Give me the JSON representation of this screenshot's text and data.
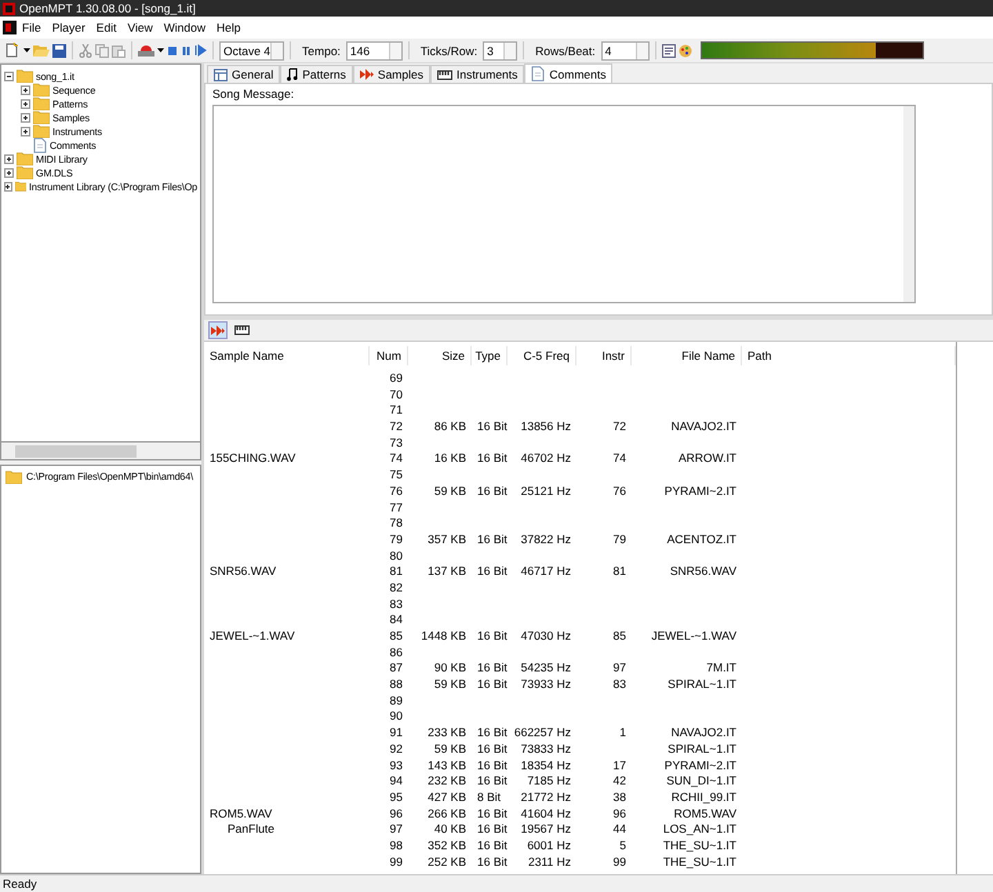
{
  "window": {
    "title": "OpenMPT 1.30.08.00 - [song_1.it]"
  },
  "menu": [
    "File",
    "Player",
    "Edit",
    "View",
    "Window",
    "Help"
  ],
  "toolbar": {
    "octave": "Octave 4",
    "tempo_label": "Tempo:",
    "tempo": "146",
    "ticks_label": "Ticks/Row:",
    "ticks": "3",
    "rows_label": "Rows/Beat:",
    "rows": "4",
    "vu_meter": {
      "level": 0.79
    }
  },
  "tree": [
    {
      "label": "song_1.it",
      "kind": "folder",
      "expanded": true,
      "children": [
        {
          "label": "Sequence",
          "kind": "folder",
          "expanded": false
        },
        {
          "label": "Patterns",
          "kind": "folder",
          "expanded": false
        },
        {
          "label": "Samples",
          "kind": "folder",
          "expanded": false
        },
        {
          "label": "Instruments",
          "kind": "folder",
          "expanded": false
        },
        {
          "label": "Comments",
          "kind": "document"
        }
      ]
    },
    {
      "label": "MIDI Library",
      "kind": "folder",
      "expanded": false
    },
    {
      "label": "GM.DLS",
      "kind": "folder",
      "expanded": false
    },
    {
      "label": "Instrument Library (C:\\Program Files\\Op",
      "kind": "folder",
      "expanded": false
    }
  ],
  "folder_path": "C:\\Program Files\\OpenMPT\\bin\\amd64\\",
  "tabs": [
    {
      "label": "General",
      "selected": false
    },
    {
      "label": "Patterns",
      "selected": false
    },
    {
      "label": "Samples",
      "selected": false
    },
    {
      "label": "Instruments",
      "selected": false
    },
    {
      "label": "Comments",
      "selected": true
    }
  ],
  "song_message_label": "Song Message:",
  "sample_list": {
    "columns": [
      "Sample Name",
      "Num",
      "Size",
      "Type",
      "C-5 Freq",
      "Instr",
      "File Name",
      "Path"
    ],
    "rows": [
      {
        "num": "69"
      },
      {
        "num": "70"
      },
      {
        "num": "71"
      },
      {
        "num": "72",
        "size": "86 KB",
        "type": "16 Bit",
        "freq": "13856 Hz",
        "instr": "72",
        "file": "NAVAJO2.IT"
      },
      {
        "num": "73"
      },
      {
        "name": "155CHING.WAV",
        "num": "74",
        "size": "16 KB",
        "type": "16 Bit",
        "freq": "46702 Hz",
        "instr": "74",
        "file": "ARROW.IT"
      },
      {
        "num": "75"
      },
      {
        "num": "76",
        "size": "59 KB",
        "type": "16 Bit",
        "freq": "25121 Hz",
        "instr": "76",
        "file": "PYRAMI~2.IT"
      },
      {
        "num": "77"
      },
      {
        "num": "78"
      },
      {
        "num": "79",
        "size": "357 KB",
        "type": "16 Bit",
        "freq": "37822 Hz",
        "instr": "79",
        "file": "ACENTOZ.IT"
      },
      {
        "num": "80"
      },
      {
        "name": "SNR56.WAV",
        "num": "81",
        "size": "137 KB",
        "type": "16 Bit",
        "freq": "46717 Hz",
        "instr": "81",
        "file": "SNR56.WAV"
      },
      {
        "num": "82"
      },
      {
        "num": "83"
      },
      {
        "num": "84"
      },
      {
        "name": "JEWEL-~1.WAV",
        "num": "85",
        "size": "1448 KB",
        "type": "16 Bit",
        "freq": "47030 Hz",
        "instr": "85",
        "file": "JEWEL-~1.WAV"
      },
      {
        "num": "86"
      },
      {
        "num": "87",
        "size": "90 KB",
        "type": "16 Bit",
        "freq": "54235 Hz",
        "instr": "97",
        "file": "7M.IT"
      },
      {
        "num": "88",
        "size": "59 KB",
        "type": "16 Bit",
        "freq": "73933 Hz",
        "instr": "83",
        "file": "SPIRAL~1.IT"
      },
      {
        "num": "89"
      },
      {
        "num": "90"
      },
      {
        "num": "91",
        "size": "233 KB",
        "type": "16 Bit",
        "freq": "662257 Hz",
        "instr": "1",
        "file": "NAVAJO2.IT"
      },
      {
        "num": "92",
        "size": "59 KB",
        "type": "16 Bit",
        "freq": "73833 Hz",
        "file": "SPIRAL~1.IT"
      },
      {
        "num": "93",
        "size": "143 KB",
        "type": "16 Bit",
        "freq": "18354 Hz",
        "instr": "17",
        "file": "PYRAMI~2.IT"
      },
      {
        "num": "94",
        "size": "232 KB",
        "type": "16 Bit",
        "freq": "7185 Hz",
        "instr": "42",
        "file": "SUN_DI~1.IT"
      },
      {
        "num": "95",
        "size": "427 KB",
        "type": "8 Bit",
        "freq": "21772 Hz",
        "instr": "38",
        "file": "RCHII_99.IT"
      },
      {
        "name": "ROM5.WAV",
        "num": "96",
        "size": "266 KB",
        "type": "16 Bit",
        "freq": "41604 Hz",
        "instr": "96",
        "file": "ROM5.WAV"
      },
      {
        "instrument_name": "PanFlute",
        "num": "97",
        "size": "40 KB",
        "type": "16 Bit",
        "freq": "19567 Hz",
        "instr": "44",
        "file": "LOS_AN~1.IT"
      },
      {
        "num": "98",
        "size": "352 KB",
        "type": "16 Bit",
        "freq": "6001 Hz",
        "instr": "5",
        "file": "THE_SU~1.IT"
      },
      {
        "num": "99",
        "size": "252 KB",
        "type": "16 Bit",
        "freq": "2311 Hz",
        "instr": "99",
        "file": "THE_SU~1.IT"
      }
    ]
  },
  "status_bar": "Ready"
}
